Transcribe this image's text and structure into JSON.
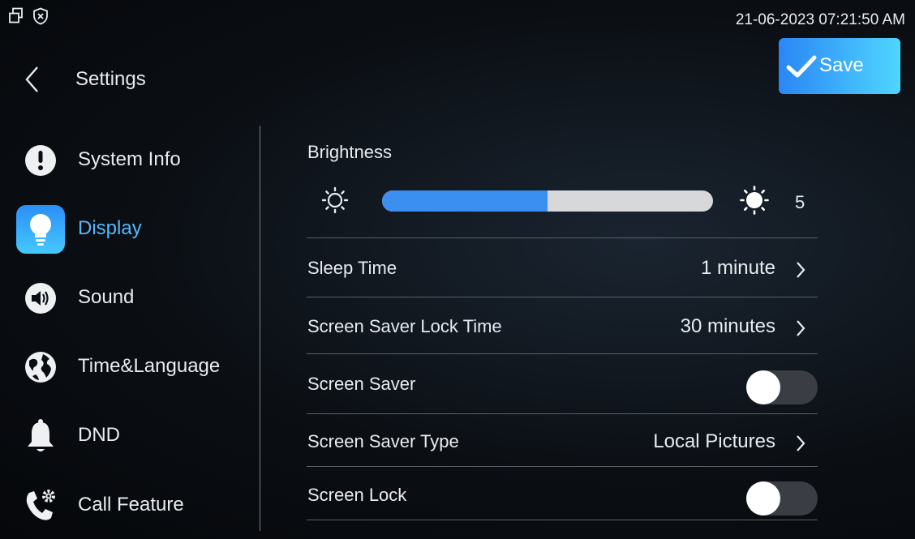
{
  "status": {
    "datetime": "21-06-2023 07:21:50 AM"
  },
  "header": {
    "title": "Settings",
    "save_label": "Save"
  },
  "sidebar": {
    "items": [
      {
        "label": "System Info",
        "icon": "info-icon",
        "active": false
      },
      {
        "label": "Display",
        "icon": "bulb-icon",
        "active": true
      },
      {
        "label": "Sound",
        "icon": "speaker-icon",
        "active": false
      },
      {
        "label": "Time&Language",
        "icon": "globe-icon",
        "active": false
      },
      {
        "label": "DND",
        "icon": "bell-icon",
        "active": false
      },
      {
        "label": "Call Feature",
        "icon": "phone-gear-icon",
        "active": false
      }
    ]
  },
  "display": {
    "brightness_label": "Brightness",
    "brightness_value": "5",
    "brightness_fraction": 0.5,
    "rows": [
      {
        "label": "Sleep Time",
        "value": "1 minute"
      },
      {
        "label": "Screen Saver Lock Time",
        "value": "30 minutes"
      },
      {
        "label": "Screen Saver",
        "toggle": false
      },
      {
        "label": "Screen Saver Type",
        "value": "Local Pictures"
      },
      {
        "label": "Screen Lock",
        "toggle": false
      }
    ]
  },
  "colors": {
    "accent": "#3b8ff0",
    "active_text": "#54b8ff"
  }
}
